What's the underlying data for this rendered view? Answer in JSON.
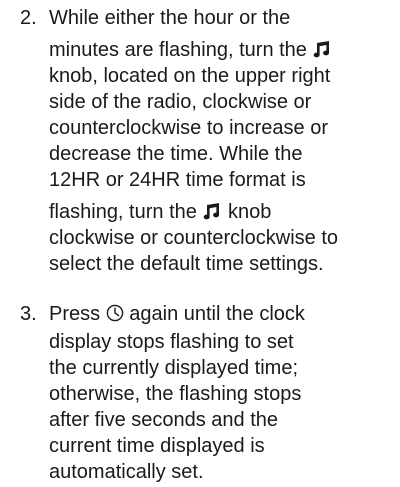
{
  "steps": [
    {
      "number": "2.",
      "lines": [
        {
          "text": "While either the hour or the"
        },
        {
          "text": "minutes are flashing, turn the",
          "icon": "music-note-icon"
        },
        {
          "text": "knob, located on the upper right"
        },
        {
          "text": "side of the radio, clockwise or"
        },
        {
          "text": "counterclockwise to increase or"
        },
        {
          "text": "decrease the time. While the"
        },
        {
          "text": "12HR or 24HR time format is"
        },
        {
          "text": "flashing, turn the",
          "icon": "music-note-icon",
          "after": "knob"
        },
        {
          "text": "clockwise or counterclockwise to"
        },
        {
          "text": "select the default time settings."
        }
      ]
    },
    {
      "number": "3.",
      "lines": [
        {
          "text": "Press",
          "icon": "clock-icon",
          "after": "again until the clock"
        },
        {
          "text": "display stops flashing to set"
        },
        {
          "text": "the currently displayed time;"
        },
        {
          "text": "otherwise, the flashing stops"
        },
        {
          "text": "after five seconds and the"
        },
        {
          "text": "current time displayed is"
        },
        {
          "text": "automatically set."
        }
      ]
    }
  ]
}
